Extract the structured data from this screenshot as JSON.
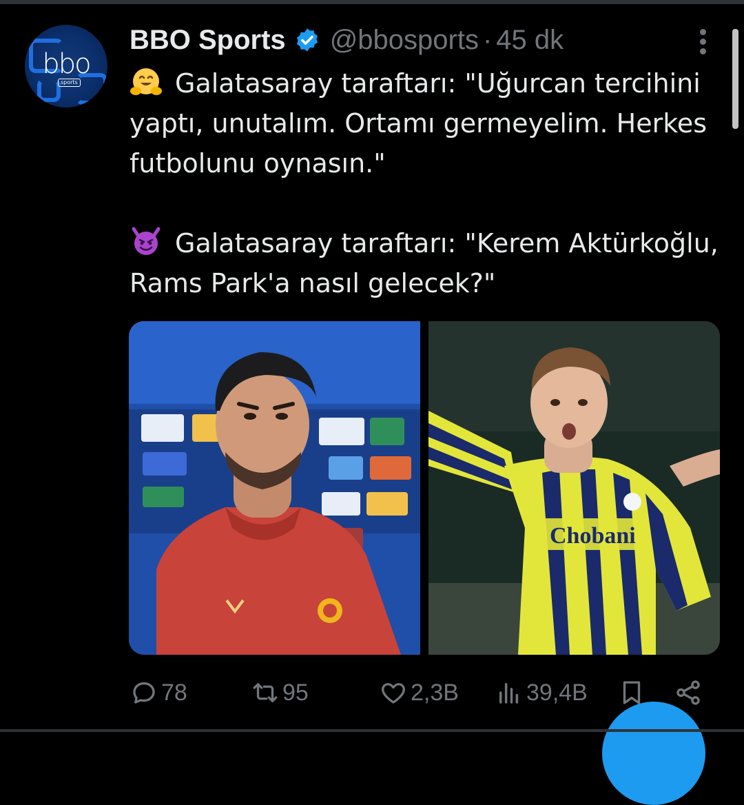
{
  "tweet": {
    "author_name": "BBO Sports",
    "handle": "@bbosports",
    "separator": "·",
    "time_ago": "45 dk",
    "avatar_logo_text": "bbo",
    "avatar_tag_text": "sports",
    "line1": "Galatasaray taraftarı: \"Uğurcan tercihini yaptı, unutalım. Ortamı germeyelim. Herkes futbolunu oynasın.\"",
    "line2": "Galatasaray taraftarı: \"Kerem Aktürkoğlu, Rams Park'a nasıl gelecek?\"",
    "emoji1": "hugging-face-emoji",
    "emoji2": "smiling-devil-emoji"
  },
  "media": {
    "right_jersey_text": "Chobani"
  },
  "actions": {
    "replies": "78",
    "reposts": "95",
    "likes": "2,3B",
    "views": "39,4B"
  },
  "colors": {
    "background": "#000000",
    "text": "#e7e9ea",
    "muted": "#71767b",
    "accent": "#1d9bf0"
  }
}
